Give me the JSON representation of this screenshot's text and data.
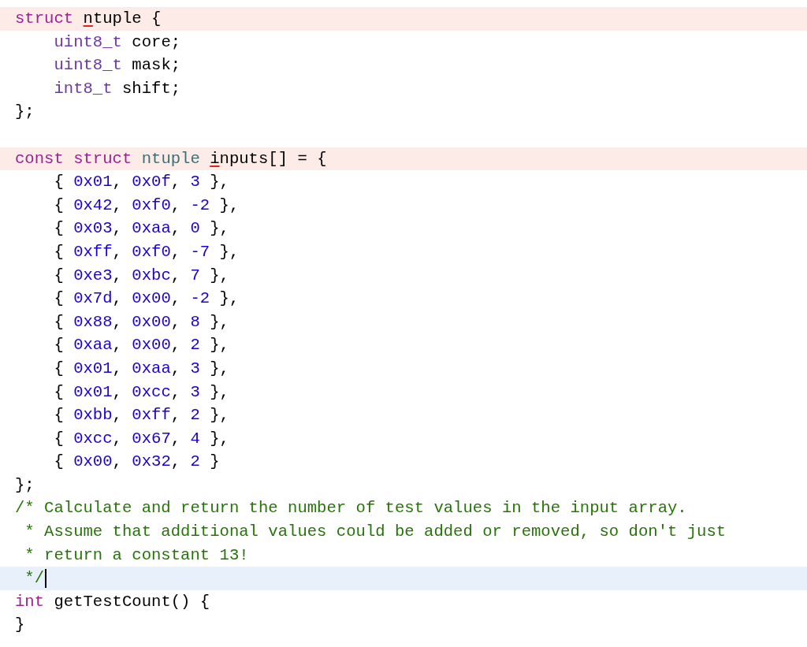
{
  "editor": {
    "lines": [
      {
        "kind": "code",
        "issue": true,
        "current": false,
        "tokens": [
          {
            "text": "struct ",
            "kind": "keyword"
          },
          {
            "text": "n",
            "kind": "flagged"
          },
          {
            "text": "tuple {",
            "kind": "plain"
          }
        ]
      },
      {
        "kind": "code",
        "issue": false,
        "current": false,
        "tokens": [
          {
            "text": "    uint8_t",
            "kind": "type"
          },
          {
            "text": " core;",
            "kind": "plain"
          }
        ]
      },
      {
        "kind": "code",
        "issue": false,
        "current": false,
        "tokens": [
          {
            "text": "    uint8_t",
            "kind": "type"
          },
          {
            "text": " mask;",
            "kind": "plain"
          }
        ]
      },
      {
        "kind": "code",
        "issue": false,
        "current": false,
        "tokens": [
          {
            "text": "    int8_t",
            "kind": "type"
          },
          {
            "text": " shift;",
            "kind": "plain"
          }
        ]
      },
      {
        "kind": "code",
        "issue": false,
        "current": false,
        "tokens": [
          {
            "text": "};",
            "kind": "plain"
          }
        ]
      },
      {
        "kind": "blank"
      },
      {
        "kind": "code",
        "issue": true,
        "current": false,
        "tokens": [
          {
            "text": "const struct ",
            "kind": "keyword"
          },
          {
            "text": "ntuple ",
            "kind": "usertype"
          },
          {
            "text": "i",
            "kind": "flagged"
          },
          {
            "text": "nputs[] = {",
            "kind": "plain"
          }
        ]
      },
      {
        "kind": "code",
        "issue": false,
        "current": false,
        "tokens": [
          {
            "text": "    { ",
            "kind": "plain"
          },
          {
            "text": "0x01",
            "kind": "number"
          },
          {
            "text": ", ",
            "kind": "plain"
          },
          {
            "text": "0x0f",
            "kind": "number"
          },
          {
            "text": ", ",
            "kind": "plain"
          },
          {
            "text": "3",
            "kind": "number"
          },
          {
            "text": " },",
            "kind": "plain"
          }
        ]
      },
      {
        "kind": "code",
        "issue": false,
        "current": false,
        "tokens": [
          {
            "text": "    { ",
            "kind": "plain"
          },
          {
            "text": "0x42",
            "kind": "number"
          },
          {
            "text": ", ",
            "kind": "plain"
          },
          {
            "text": "0xf0",
            "kind": "number"
          },
          {
            "text": ", ",
            "kind": "plain"
          },
          {
            "text": "-2",
            "kind": "number"
          },
          {
            "text": " },",
            "kind": "plain"
          }
        ]
      },
      {
        "kind": "code",
        "issue": false,
        "current": false,
        "tokens": [
          {
            "text": "    { ",
            "kind": "plain"
          },
          {
            "text": "0x03",
            "kind": "number"
          },
          {
            "text": ", ",
            "kind": "plain"
          },
          {
            "text": "0xaa",
            "kind": "number"
          },
          {
            "text": ", ",
            "kind": "plain"
          },
          {
            "text": "0",
            "kind": "number"
          },
          {
            "text": " },",
            "kind": "plain"
          }
        ]
      },
      {
        "kind": "code",
        "issue": false,
        "current": false,
        "tokens": [
          {
            "text": "    { ",
            "kind": "plain"
          },
          {
            "text": "0xff",
            "kind": "number"
          },
          {
            "text": ", ",
            "kind": "plain"
          },
          {
            "text": "0xf0",
            "kind": "number"
          },
          {
            "text": ", ",
            "kind": "plain"
          },
          {
            "text": "-7",
            "kind": "number"
          },
          {
            "text": " },",
            "kind": "plain"
          }
        ]
      },
      {
        "kind": "code",
        "issue": false,
        "current": false,
        "tokens": [
          {
            "text": "    { ",
            "kind": "plain"
          },
          {
            "text": "0xe3",
            "kind": "number"
          },
          {
            "text": ", ",
            "kind": "plain"
          },
          {
            "text": "0xbc",
            "kind": "number"
          },
          {
            "text": ", ",
            "kind": "plain"
          },
          {
            "text": "7",
            "kind": "number"
          },
          {
            "text": " },",
            "kind": "plain"
          }
        ]
      },
      {
        "kind": "code",
        "issue": false,
        "current": false,
        "tokens": [
          {
            "text": "    { ",
            "kind": "plain"
          },
          {
            "text": "0x7d",
            "kind": "number"
          },
          {
            "text": ", ",
            "kind": "plain"
          },
          {
            "text": "0x00",
            "kind": "number"
          },
          {
            "text": ", ",
            "kind": "plain"
          },
          {
            "text": "-2",
            "kind": "number"
          },
          {
            "text": " },",
            "kind": "plain"
          }
        ]
      },
      {
        "kind": "code",
        "issue": false,
        "current": false,
        "tokens": [
          {
            "text": "    { ",
            "kind": "plain"
          },
          {
            "text": "0x88",
            "kind": "number"
          },
          {
            "text": ", ",
            "kind": "plain"
          },
          {
            "text": "0x00",
            "kind": "number"
          },
          {
            "text": ", ",
            "kind": "plain"
          },
          {
            "text": "8",
            "kind": "number"
          },
          {
            "text": " },",
            "kind": "plain"
          }
        ]
      },
      {
        "kind": "code",
        "issue": false,
        "current": false,
        "tokens": [
          {
            "text": "    { ",
            "kind": "plain"
          },
          {
            "text": "0xaa",
            "kind": "number"
          },
          {
            "text": ", ",
            "kind": "plain"
          },
          {
            "text": "0x00",
            "kind": "number"
          },
          {
            "text": ", ",
            "kind": "plain"
          },
          {
            "text": "2",
            "kind": "number"
          },
          {
            "text": " },",
            "kind": "plain"
          }
        ]
      },
      {
        "kind": "code",
        "issue": false,
        "current": false,
        "tokens": [
          {
            "text": "    { ",
            "kind": "plain"
          },
          {
            "text": "0x01",
            "kind": "number"
          },
          {
            "text": ", ",
            "kind": "plain"
          },
          {
            "text": "0xaa",
            "kind": "number"
          },
          {
            "text": ", ",
            "kind": "plain"
          },
          {
            "text": "3",
            "kind": "number"
          },
          {
            "text": " },",
            "kind": "plain"
          }
        ]
      },
      {
        "kind": "code",
        "issue": false,
        "current": false,
        "tokens": [
          {
            "text": "    { ",
            "kind": "plain"
          },
          {
            "text": "0x01",
            "kind": "number"
          },
          {
            "text": ", ",
            "kind": "plain"
          },
          {
            "text": "0xcc",
            "kind": "number"
          },
          {
            "text": ", ",
            "kind": "plain"
          },
          {
            "text": "3",
            "kind": "number"
          },
          {
            "text": " },",
            "kind": "plain"
          }
        ]
      },
      {
        "kind": "code",
        "issue": false,
        "current": false,
        "tokens": [
          {
            "text": "    { ",
            "kind": "plain"
          },
          {
            "text": "0xbb",
            "kind": "number"
          },
          {
            "text": ", ",
            "kind": "plain"
          },
          {
            "text": "0xff",
            "kind": "number"
          },
          {
            "text": ", ",
            "kind": "plain"
          },
          {
            "text": "2",
            "kind": "number"
          },
          {
            "text": " },",
            "kind": "plain"
          }
        ]
      },
      {
        "kind": "code",
        "issue": false,
        "current": false,
        "tokens": [
          {
            "text": "    { ",
            "kind": "plain"
          },
          {
            "text": "0xcc",
            "kind": "number"
          },
          {
            "text": ", ",
            "kind": "plain"
          },
          {
            "text": "0x67",
            "kind": "number"
          },
          {
            "text": ", ",
            "kind": "plain"
          },
          {
            "text": "4",
            "kind": "number"
          },
          {
            "text": " },",
            "kind": "plain"
          }
        ]
      },
      {
        "kind": "code",
        "issue": false,
        "current": false,
        "tokens": [
          {
            "text": "    { ",
            "kind": "plain"
          },
          {
            "text": "0x00",
            "kind": "number"
          },
          {
            "text": ", ",
            "kind": "plain"
          },
          {
            "text": "0x32",
            "kind": "number"
          },
          {
            "text": ", ",
            "kind": "plain"
          },
          {
            "text": "2",
            "kind": "number"
          },
          {
            "text": " }",
            "kind": "plain"
          }
        ]
      },
      {
        "kind": "code",
        "issue": false,
        "current": false,
        "tokens": [
          {
            "text": "};",
            "kind": "plain"
          }
        ]
      },
      {
        "kind": "code",
        "issue": false,
        "current": false,
        "tokens": [
          {
            "text": "/* Calculate and return the number of test values in the input array.",
            "kind": "comment"
          }
        ]
      },
      {
        "kind": "code",
        "issue": false,
        "current": false,
        "tokens": [
          {
            "text": " * Assume that additional values could be added or removed, so don't just",
            "kind": "comment"
          }
        ]
      },
      {
        "kind": "code",
        "issue": false,
        "current": false,
        "tokens": [
          {
            "text": " * return a constant 13!",
            "kind": "comment"
          }
        ]
      },
      {
        "kind": "code",
        "issue": false,
        "current": true,
        "tokens": [
          {
            "text": " */",
            "kind": "comment"
          }
        ]
      },
      {
        "kind": "code",
        "issue": false,
        "current": false,
        "tokens": [
          {
            "text": "int",
            "kind": "keyword"
          },
          {
            "text": " getTestCount() {",
            "kind": "plain"
          }
        ]
      },
      {
        "kind": "code",
        "issue": false,
        "current": false,
        "tokens": [
          {
            "text": "}",
            "kind": "plain"
          }
        ]
      }
    ]
  }
}
